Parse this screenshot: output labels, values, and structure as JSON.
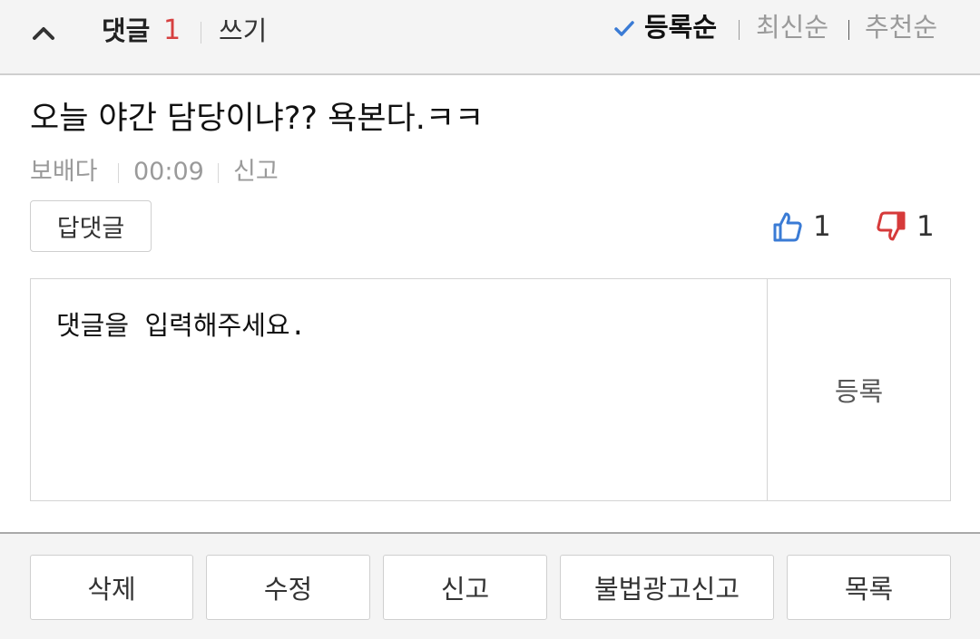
{
  "header": {
    "comment_label": "댓글",
    "comment_count": "1",
    "write_label": "쓰기",
    "sort_options": [
      {
        "label": "등록순",
        "active": true
      },
      {
        "label": "최신순",
        "active": false
      },
      {
        "label": "추천순",
        "active": false
      }
    ]
  },
  "comment": {
    "text": "오늘 야간 담당이냐?? 욕본다.ㅋㅋ",
    "author": "보배다",
    "time": "00:09",
    "report_label": "신고",
    "reply_label": "답댓글",
    "likes": "1",
    "dislikes": "1"
  },
  "reply_form": {
    "placeholder": "댓글을 입력해주세요.",
    "submit_label": "등록"
  },
  "actions": {
    "delete_label": "삭제",
    "edit_label": "수정",
    "report_label": "신고",
    "illegal_ad_report_label": "불법광고신고",
    "list_label": "목록"
  },
  "colors": {
    "count_accent": "#d64040",
    "check_accent": "#3a7bd5",
    "like_icon": "#3a7bd5",
    "dislike_icon": "#d63a3a"
  },
  "icons": {
    "collapse": "chevron-up-icon",
    "sort_check": "check-icon",
    "like": "thumbs-up-icon",
    "dislike": "thumbs-down-icon"
  }
}
